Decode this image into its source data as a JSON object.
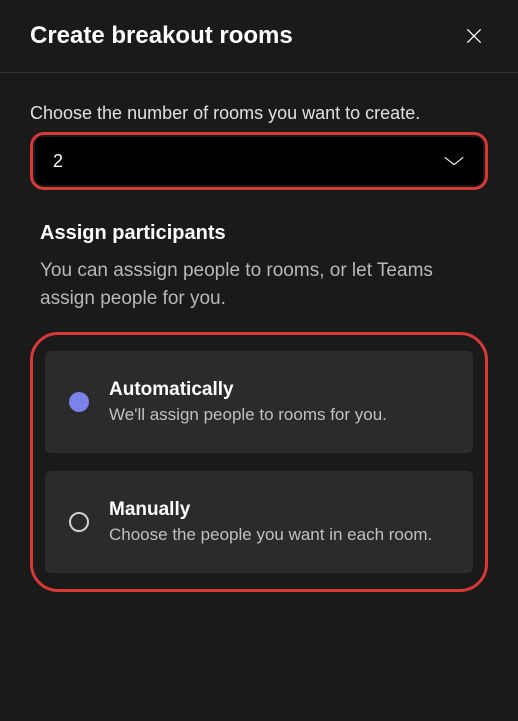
{
  "header": {
    "title": "Create breakout rooms"
  },
  "roomCount": {
    "label": "Choose the number of rooms you want to create.",
    "value": "2"
  },
  "assign": {
    "title": "Assign participants",
    "description": "You can asssign people to rooms, or let Teams assign people for you.",
    "options": {
      "automatic": {
        "title": "Automatically",
        "description": "We'll assign people to rooms for you."
      },
      "manual": {
        "title": "Manually",
        "description": "Choose the people you want in each room."
      }
    }
  }
}
